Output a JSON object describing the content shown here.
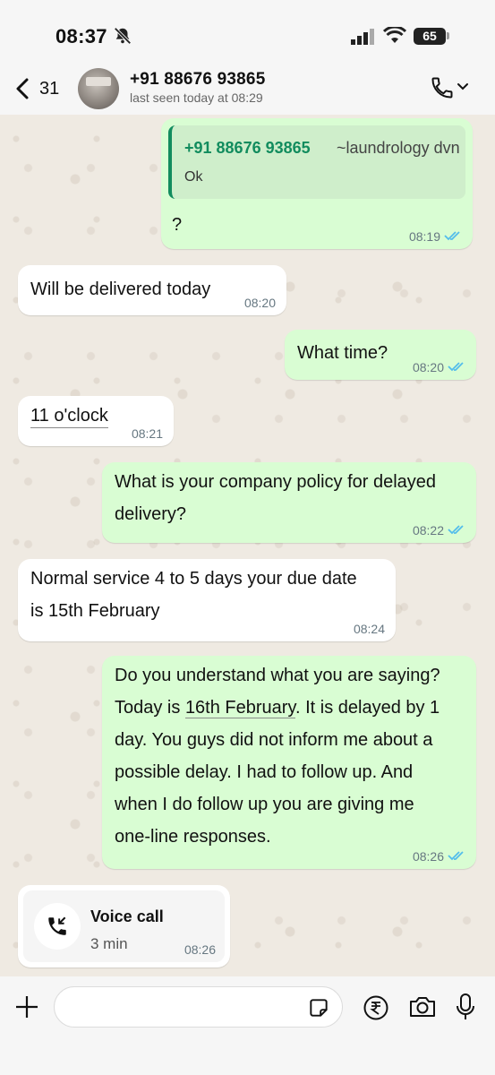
{
  "status_bar": {
    "time": "08:37",
    "battery": "65"
  },
  "header": {
    "back_count": "31",
    "contact_name": "+91 88676 93865",
    "last_seen": "last seen today at 08:29"
  },
  "messages": [
    {
      "direction": "outgoing",
      "quote": {
        "name": "+91 88676 93865",
        "sender": "~laundrology dvn",
        "text": "Ok"
      },
      "text": "?",
      "time": "08:19",
      "status": "read"
    },
    {
      "direction": "incoming",
      "text": "Will be delivered today",
      "time": "08:20"
    },
    {
      "direction": "outgoing",
      "text": "What time?",
      "time": "08:20",
      "status": "read"
    },
    {
      "direction": "incoming",
      "text": "11 o'clock",
      "time": "08:21"
    },
    {
      "direction": "outgoing",
      "lines": [
        "What is your company policy for delayed",
        "delivery?"
      ],
      "time": "08:22",
      "status": "read"
    },
    {
      "direction": "incoming",
      "lines": [
        "Normal service 4 to 5 days your due date",
        "is 15th February"
      ],
      "time": "08:24"
    },
    {
      "direction": "outgoing",
      "lines": [
        "Do you understand what you are saying?",
        "Today is ",
        "16th February",
        ". It is delayed by 1",
        "day. You guys did not inform me about a",
        "possible delay. I had to follow up. And",
        "when I do follow up you are giving me",
        "one-line responses."
      ],
      "time": "08:26",
      "status": "read"
    }
  ],
  "voice_call": {
    "title": "Voice call",
    "duration": "3 min",
    "time": "08:26"
  },
  "input": {
    "placeholder": ""
  },
  "colors": {
    "outgoing_bubble": "#d9fdd3",
    "incoming_bubble": "#ffffff",
    "accent_green": "#128c5e",
    "read_ticks": "#53bdeb",
    "chat_background": "#efeae2"
  },
  "icons": [
    "bell-slash-icon",
    "signal-icon",
    "wifi-icon",
    "back-chevron-icon",
    "phone-icon",
    "chevron-down-icon",
    "double-check-icon",
    "incoming-call-icon",
    "plus-icon",
    "sticker-icon",
    "rupee-icon",
    "camera-icon",
    "mic-icon"
  ]
}
